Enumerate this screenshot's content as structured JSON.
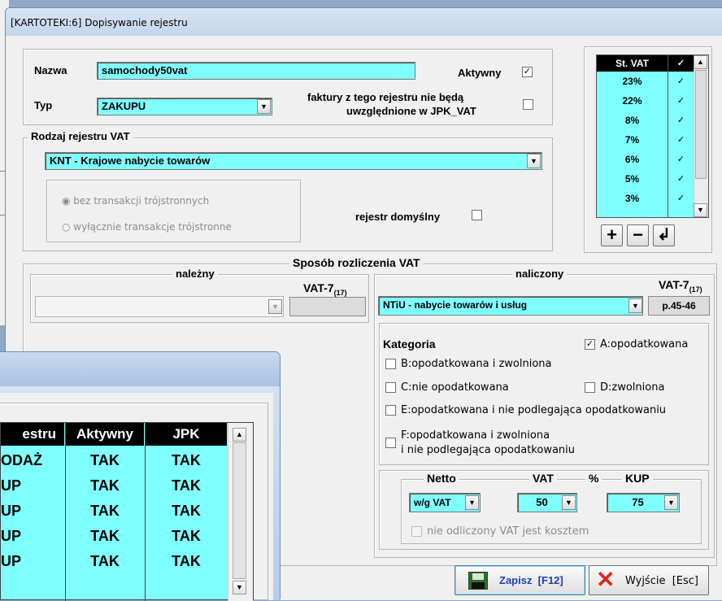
{
  "window": {
    "title": "[KARTOTEKI:6]  Dopisywanie rejestru"
  },
  "form": {
    "nazwa_label": "Nazwa",
    "nazwa_value": "samochody50vat",
    "aktywny_label": "Aktywny",
    "aktywny_checked": true,
    "typ_label": "Typ",
    "typ_value": "ZAKUPU",
    "jpk_exclude_line1": "faktury z tego rejestru nie będą",
    "jpk_exclude_line2": "uwzględnione w JPK_VAT"
  },
  "rodzaj": {
    "title": "Rodzaj rejestru VAT",
    "select_value": "KNT - Krajowe nabycie towarów",
    "radio1": "bez transakcji trójstronnych",
    "radio2": "wyłącznie transakcje trójstronne",
    "default_label": "rejestr domyślny"
  },
  "stvat": {
    "header": "St. VAT",
    "header_check": "✓",
    "rows": [
      "23%",
      "22%",
      "8%",
      "7%",
      "6%",
      "5%",
      "3%"
    ]
  },
  "toolbar": {
    "add": "+",
    "remove": "−",
    "enter": "↲"
  },
  "sposob": {
    "title": "Sposób rozliczenia VAT",
    "nalezny_title": "należny",
    "naliczony_title": "naliczony",
    "vat7_label": "VAT-7",
    "vat7_sub": "(17)",
    "naliczony_select": "NTiU   - nabycie towarów i usług",
    "page_ref": "p.45-46"
  },
  "kategoria": {
    "title": "Kategoria",
    "a": "A:opodatkowana",
    "b": "B:opodatkowana i zwolniona",
    "c": "C:nie opodatkowana",
    "d": "D:zwolniona",
    "e": "E:opodatkowana i nie podlegająca opodatkowaniu",
    "f1": "F:opodatkowana  i zwolniona",
    "f2": "i nie podlegająca opodatkowaniu"
  },
  "netto": {
    "netto_title": "Netto",
    "vat_title": "VAT",
    "pct": "%",
    "kup_title": "KUP",
    "netto_value": "w/g VAT",
    "vat_value": "50",
    "kup_value": "75",
    "cost_label": "nie odliczony VAT jest kosztem"
  },
  "buttons": {
    "save": "Zapisz  [F12]",
    "exit": "Wyjście  [Esc]"
  },
  "back_table": {
    "headers": [
      "estru",
      "Aktywny",
      "JPK"
    ],
    "rows": [
      [
        "ODAŻ",
        "TAK",
        "TAK"
      ],
      [
        "UP",
        "TAK",
        "TAK"
      ],
      [
        "UP",
        "TAK",
        "TAK"
      ],
      [
        "UP",
        "TAK",
        "TAK"
      ],
      [
        "UP",
        "TAK",
        "TAK"
      ]
    ]
  }
}
